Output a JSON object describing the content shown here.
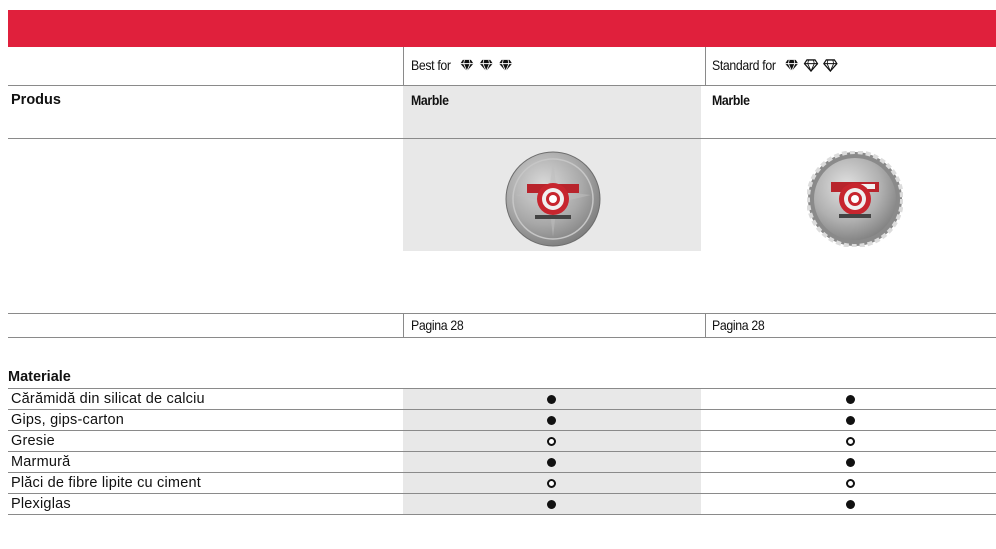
{
  "header": {
    "best_for_label": "Best for",
    "standard_for_label": "Standard for",
    "product_label": "Produs",
    "product_1_name": "Marble",
    "product_2_name": "Marble",
    "page_1_label": "Pagina 28",
    "page_2_label": "Pagina 28"
  },
  "ratings": {
    "best_for": [
      "filled-diamond",
      "filled-diamond",
      "filled-diamond"
    ],
    "standard_for": [
      "filled-diamond",
      "outline-diamond",
      "outline-diamond"
    ]
  },
  "materials": {
    "title": "Materiale",
    "rows": [
      {
        "name": "Cărămidă din silicat de calciu",
        "p1": "full",
        "p2": "full"
      },
      {
        "name": "Gips, gips-carton",
        "p1": "full",
        "p2": "full"
      },
      {
        "name": "Gresie",
        "p1": "half",
        "p2": "half"
      },
      {
        "name": "Marmură",
        "p1": "full",
        "p2": "full"
      },
      {
        "name": "Plăci de fibre lipite cu ciment",
        "p1": "half",
        "p2": "half"
      },
      {
        "name": "Plexiglas",
        "p1": "full",
        "p2": "full"
      }
    ]
  },
  "colors": {
    "accent": "#e0203c",
    "shade": "#e8e8e8",
    "rule": "#8a8a8a"
  }
}
